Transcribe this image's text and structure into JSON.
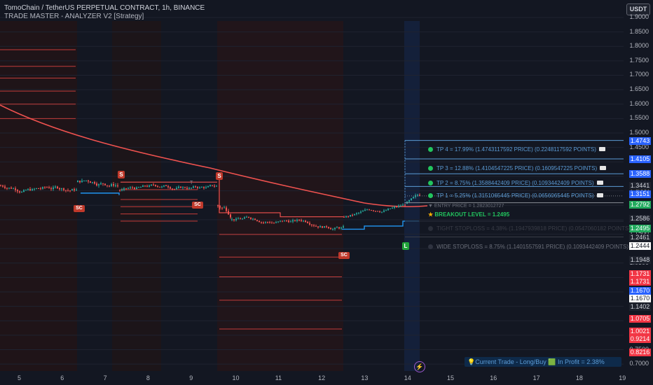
{
  "header": {
    "symbol": "TomoChain / TetherUS PERPETUAL CONTRACT, 1h, BINANCE",
    "indicator": "TRADE MASTER - ANALYZER V2 [Strategy]",
    "currency_button": "USDT"
  },
  "axis": {
    "y_ticks": [
      "1.9000",
      "1.8500",
      "1.8000",
      "1.7500",
      "1.7000",
      "1.6500",
      "1.6000",
      "1.5500",
      "1.5000",
      "1.4500",
      "1.4000",
      "1.3500",
      "1.3000",
      "1.2500",
      "1.2000",
      "1.1500",
      "1.1000",
      "1.0500",
      "1.0000",
      "0.9500",
      "0.9000",
      "0.8500",
      "0.8000",
      "0.7500",
      "0.7000"
    ],
    "x_ticks": [
      "5",
      "6",
      "7",
      "8",
      "9",
      "10",
      "11",
      "12",
      "13",
      "14",
      "15",
      "16",
      "17",
      "18",
      "19"
    ]
  },
  "price_tags": [
    {
      "text": "1.4743",
      "bg": "#2962ff",
      "fg": "#ffffff",
      "v": 1.4743
    },
    {
      "text": "1.4105",
      "bg": "#2962ff",
      "fg": "#ffffff",
      "v": 1.4105
    },
    {
      "text": "1.3588",
      "bg": "#2962ff",
      "fg": "#ffffff",
      "v": 1.3588
    },
    {
      "text": "1.3441",
      "bg": "#1e222d",
      "fg": "#d1d4dc",
      "v": 1.3441
    },
    {
      "text": "1.3151",
      "bg": "#2962ff",
      "fg": "#ffffff",
      "v": 1.3151
    },
    {
      "text": "1.2792",
      "bg": "#22ab5e",
      "fg": "#ffffff",
      "v": 1.2792
    },
    {
      "text": "1.2586",
      "bg": "#1e222d",
      "fg": "#d1d4dc",
      "v": 1.2586
    },
    {
      "text": "1.2495",
      "bg": "#22ab5e",
      "fg": "#ffffff",
      "v": 1.2495
    },
    {
      "text": "1.2461",
      "bg": "#1e222d",
      "fg": "#d1d4dc",
      "v": 1.2461
    },
    {
      "text": "1.2444",
      "bg": "#ffffff",
      "fg": "#131722",
      "v": 1.2444
    },
    {
      "text": "1.1948",
      "bg": "#1e222d",
      "fg": "#d1d4dc",
      "v": 1.1948
    },
    {
      "text": "1.1731",
      "bg": "#f23645",
      "fg": "#ffffff",
      "v": 1.1731
    },
    {
      "text": "1.1731",
      "bg": "#f23645",
      "fg": "#ffffff",
      "v": 1.1731
    },
    {
      "text": "1.1670",
      "bg": "#2962ff",
      "fg": "#ffffff",
      "v": 1.167
    },
    {
      "text": "1.1670",
      "bg": "#ffffff",
      "fg": "#131722",
      "v": 1.167
    },
    {
      "text": "1.1402",
      "bg": "#1e222d",
      "fg": "#d1d4dc",
      "v": 1.1402
    },
    {
      "text": "1.0705",
      "bg": "#f23645",
      "fg": "#ffffff",
      "v": 1.0705
    },
    {
      "text": "1.0021",
      "bg": "#f23645",
      "fg": "#ffffff",
      "v": 1.0021
    },
    {
      "text": "0.9214",
      "bg": "#f23645",
      "fg": "#ffffff",
      "v": 0.9214
    },
    {
      "text": "0.8216",
      "bg": "#f23645",
      "fg": "#ffffff",
      "v": 0.8216
    }
  ],
  "take_profits": [
    {
      "label": "TP 4 = 17.99% (1.4743117592 PRICE) (0.2248117592 POINTS)",
      "v": 1.4743
    },
    {
      "label": "TP 3 = 12.88% (1.4104547225 PRICE) (0.1609547225 POINTS)",
      "v": 1.4105
    },
    {
      "label": "TP 2 = 8.75% (1.3588442409 PRICE) (0.1093442409 POINTS)",
      "v": 1.3588
    },
    {
      "label": "TP 1 = 5.25% (1.3151065445 PRICE) (0.0656065445 POINTS)",
      "v": 1.3151
    }
  ],
  "levels": {
    "entry": "ENTRY PRICE = 1.2823012727",
    "breakout": "BREAKOUT LEVEL = 1.2495",
    "tight_stop": "TIGHT STOPLOSS = 4.38% (1.1947939818 PRICE) (0.0547060182 POINTS)",
    "wide_stop": "WIDE STOPLOSS = 8.75% (1.1401557591 PRICE) (0.1093442409 POINTS)"
  },
  "signals": {
    "s": "S",
    "sc": "SC",
    "l": "L",
    "t": "T"
  },
  "status_bar": "💡Current Trade - Long/Buy 🟩 In Profit = 2.38%",
  "colors": {
    "up": "#26a69a",
    "down": "#ef5350",
    "ma": "#f0524f",
    "blue": "#2196f3",
    "target": "#5b9bd5",
    "green": "#22c55e"
  }
}
